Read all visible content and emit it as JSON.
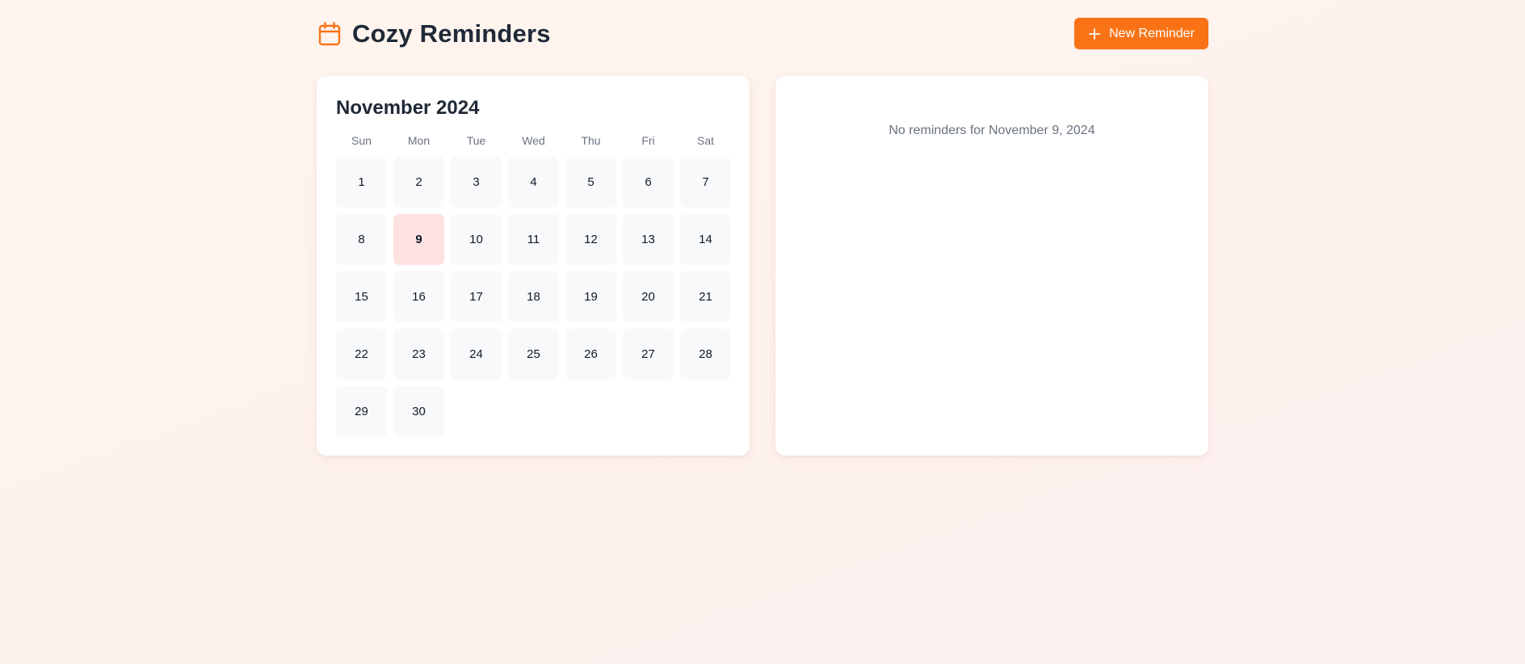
{
  "app": {
    "title": "Cozy Reminders",
    "icon": "calendar-icon",
    "accent_color": "#f97316"
  },
  "toolbar": {
    "new_button_label": "New Reminder",
    "new_button_icon": "plus-icon"
  },
  "calendar": {
    "month_label": "November 2024",
    "weekdays": [
      "Sun",
      "Mon",
      "Tue",
      "Wed",
      "Thu",
      "Fri",
      "Sat"
    ],
    "days": [
      "1",
      "2",
      "3",
      "4",
      "5",
      "6",
      "7",
      "8",
      "9",
      "10",
      "11",
      "12",
      "13",
      "14",
      "15",
      "16",
      "17",
      "18",
      "19",
      "20",
      "21",
      "22",
      "23",
      "24",
      "25",
      "26",
      "27",
      "28",
      "29",
      "30"
    ],
    "selected_day": "9",
    "selected_color": "#fee2e2"
  },
  "reminders": {
    "empty_message": "No reminders for November 9, 2024"
  }
}
